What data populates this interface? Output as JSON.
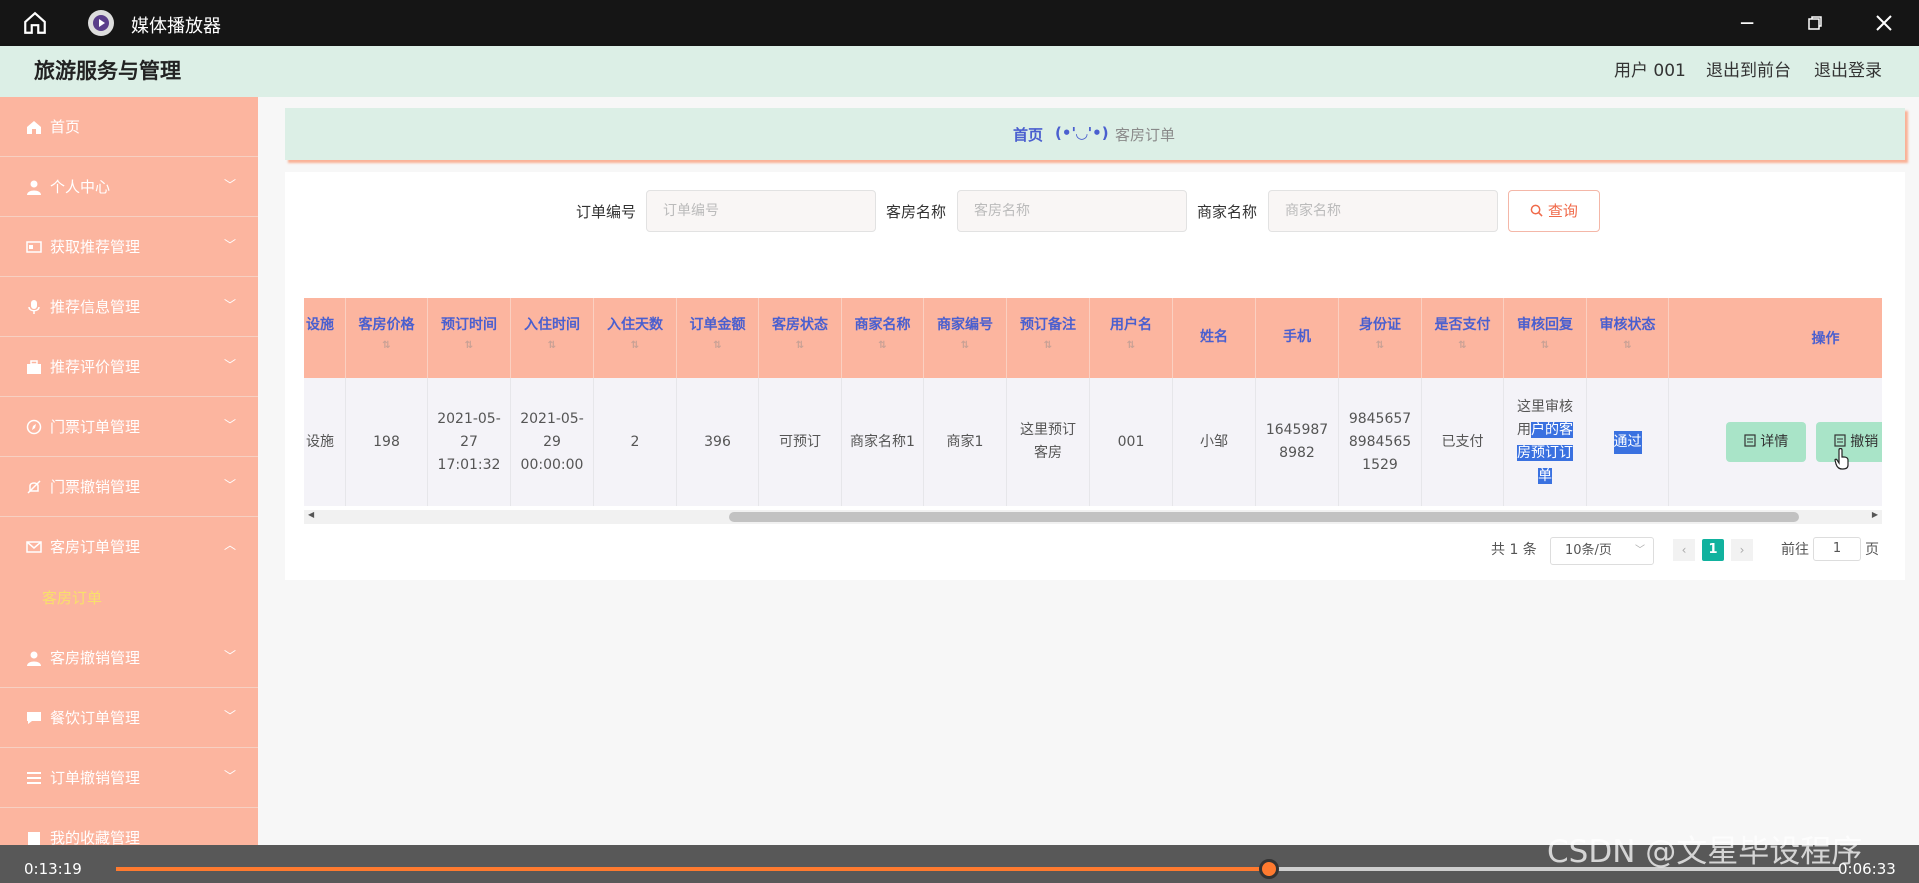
{
  "window": {
    "title": "媒体播放器"
  },
  "app": {
    "title": "旅游服务与管理"
  },
  "topnav": {
    "user": "用户 001",
    "front": "退出到前台",
    "logout": "退出登录"
  },
  "sidebar": {
    "items": [
      {
        "label": "首页",
        "icon": "home-icon"
      },
      {
        "label": "个人中心",
        "icon": "user-icon"
      },
      {
        "label": "获取推荐管理",
        "icon": "id-card-icon"
      },
      {
        "label": "推荐信息管理",
        "icon": "microphone-icon"
      },
      {
        "label": "推荐评价管理",
        "icon": "briefcase-icon"
      },
      {
        "label": "门票订单管理",
        "icon": "compass-icon"
      },
      {
        "label": "门票撤销管理",
        "icon": "bell-off-icon"
      },
      {
        "label": "客房订单管理",
        "icon": "mail-icon"
      },
      {
        "label": "客房撤销管理",
        "icon": "user-icon"
      },
      {
        "label": "餐饮订单管理",
        "icon": "chat-icon"
      },
      {
        "label": "订单撤销管理",
        "icon": "list-icon"
      },
      {
        "label": "我的收藏管理",
        "icon": "clipboard-icon"
      }
    ],
    "sub": "客房订单"
  },
  "breadcrumb": {
    "home": "首页",
    "sep": "(•'◡'•)",
    "current": "客房订单"
  },
  "search": {
    "order_label": "订单编号",
    "order_ph": "订单编号",
    "room_label": "客房名称",
    "room_ph": "客房名称",
    "merchant_label": "商家名称",
    "merchant_ph": "商家名称",
    "button": "查询"
  },
  "table": {
    "headers": [
      "设施",
      "客房价格",
      "预订时间",
      "入住时间",
      "入住天数",
      "订单金额",
      "客房状态",
      "商家名称",
      "商家编号",
      "预订备注",
      "用户名",
      "姓名",
      "手机",
      "身份证",
      "是否支付",
      "审核回复",
      "审核状态",
      "操作"
    ],
    "row": {
      "facility": "设施",
      "price": "198",
      "book_time": "2021-05-27 17:01:32",
      "checkin": "2021-05-29 00:00:00",
      "days": "2",
      "amount": "396",
      "status": "可预订",
      "merchant": "商家名称1",
      "merchant_no": "商家1",
      "remark": "这里预订客房",
      "username": "001",
      "name": "小邹",
      "phone": "16459878982",
      "idcard": "984565789845651529",
      "paid": "已支付",
      "reply_plain": "这里审核",
      "reply_hl": "户的客房预订订单",
      "reply_u": "用",
      "audit": "通过",
      "detail_btn": "详情",
      "cancel_btn": "撤销"
    }
  },
  "pager": {
    "total": "共 1 条",
    "size": "10条/页",
    "page": "1",
    "goto": "前往",
    "goto_val": "1",
    "page_unit": "页"
  },
  "player": {
    "elapsed": "0:13:19",
    "remaining": "0:06:33",
    "progress": 0.6686
  },
  "watermark": "CSDN @文星毕设程序"
}
